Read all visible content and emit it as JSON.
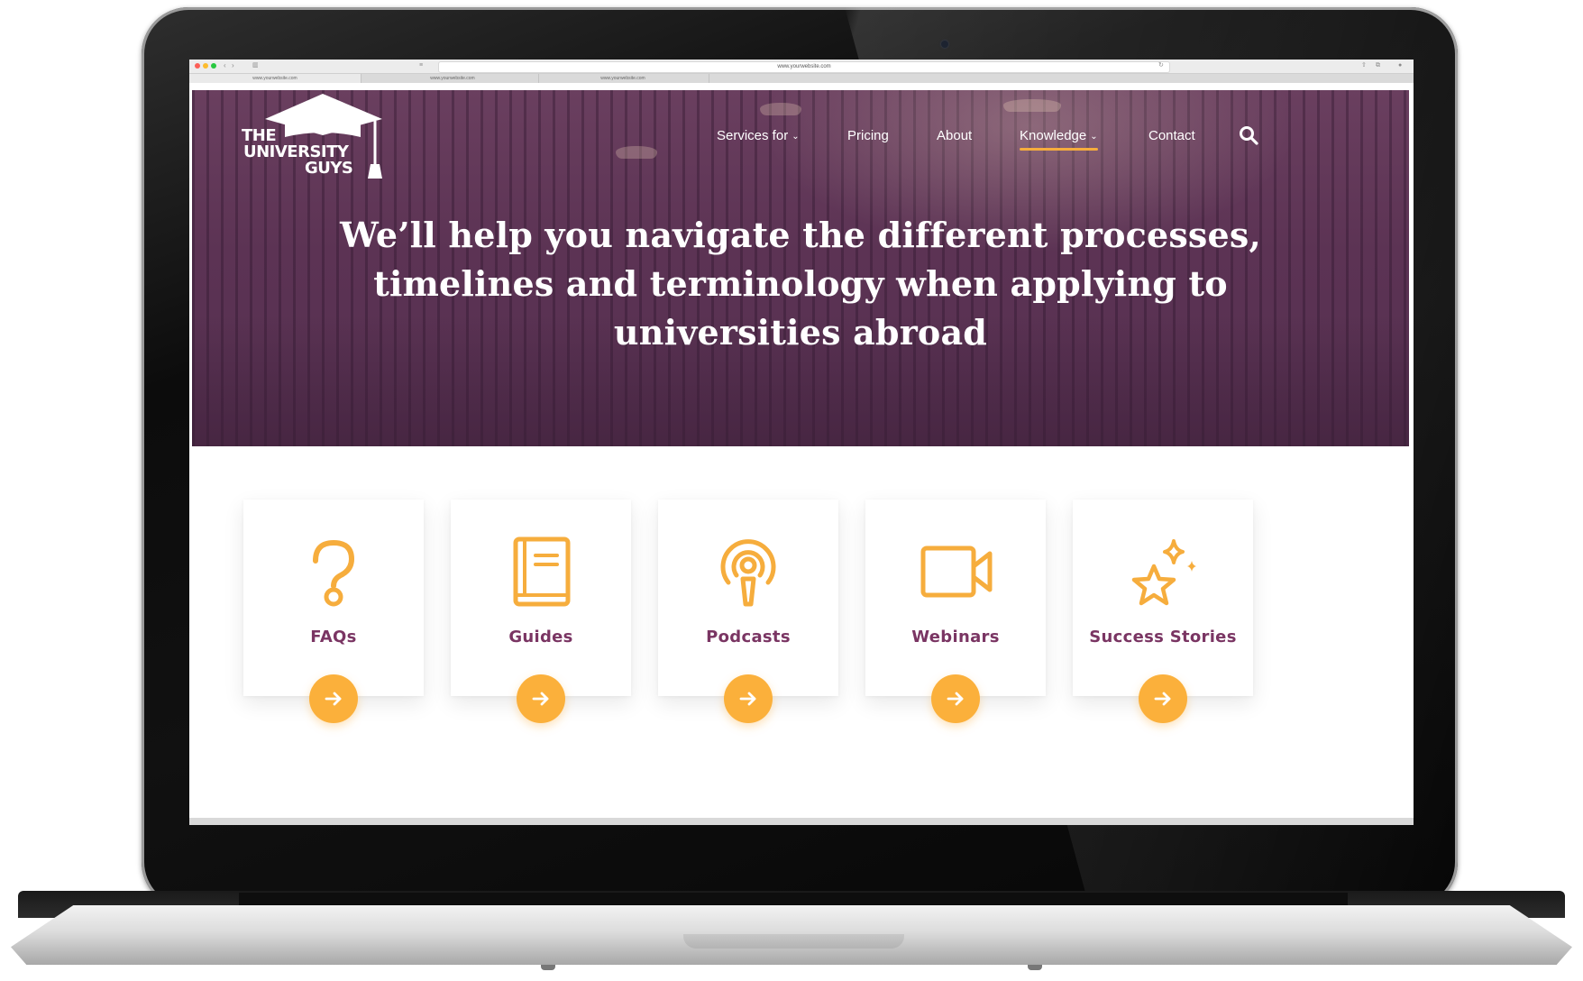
{
  "browser": {
    "url": "www.yourwebsite.com",
    "tabs": [
      "www.yourwebsite.com",
      "www.yourwebsite.com",
      "www.yourwebsite.com"
    ]
  },
  "site": {
    "logo_lines": [
      "THE",
      "UNIVERSITY",
      "GUYS"
    ],
    "nav": {
      "services": "Services for",
      "pricing": "Pricing",
      "about": "About",
      "knowledge": "Knowledge",
      "contact": "Contact"
    },
    "active_nav": "Knowledge",
    "headline_lines": [
      "We’ll help you navigate the different processes,",
      "timelines and terminology when applying to",
      "universities abroad"
    ]
  },
  "cards": [
    {
      "title": "FAQs",
      "icon": "question-icon"
    },
    {
      "title": "Guides",
      "icon": "book-icon"
    },
    {
      "title": "Podcasts",
      "icon": "podcast-icon"
    },
    {
      "title": "Webinars",
      "icon": "video-camera-icon"
    },
    {
      "title": "Success Stories",
      "icon": "star-sparkle-icon"
    }
  ],
  "colors": {
    "brand_purple": "#7a3563",
    "hero_overlay": "#5c3354",
    "accent_yellow": "#fbb03b",
    "icon_orange": "#f6ad3d"
  }
}
